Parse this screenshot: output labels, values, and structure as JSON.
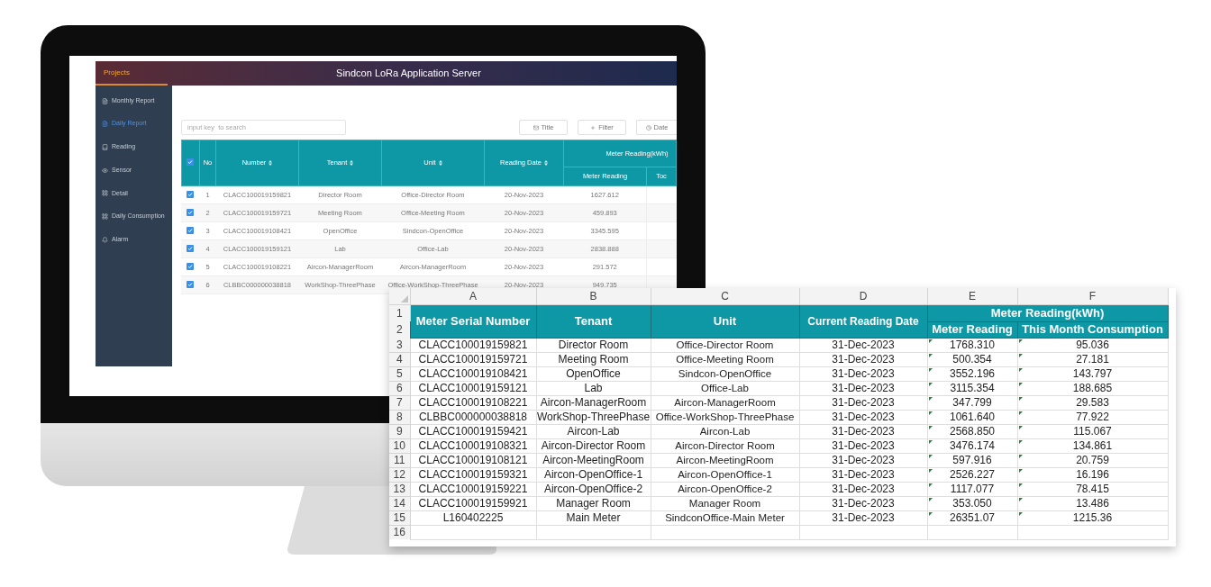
{
  "app": {
    "header": {
      "projects": "Projects",
      "title": "Sindcon LoRa Application Server"
    },
    "sidebar": [
      {
        "label": "Monthly Report",
        "selected": false
      },
      {
        "label": "Daily Report",
        "selected": true
      },
      {
        "label": "Reading",
        "selected": false
      },
      {
        "label": "Sensor",
        "selected": false
      },
      {
        "label": "Detail",
        "selected": false
      },
      {
        "label": "Daily Consumption",
        "selected": false
      },
      {
        "label": "Alarm",
        "selected": false
      }
    ],
    "search": {
      "placeholder": "input key  to search"
    },
    "buttons": [
      "Title",
      "Filter",
      "Date"
    ],
    "table": {
      "all_checked": true,
      "columns": [
        "No",
        "Number",
        "Tenant",
        "Unit",
        "Reading Date"
      ],
      "group": "Meter Reading(kWh)",
      "subcolumns": [
        "Meter Reading",
        "Toc"
      ],
      "rows": [
        {
          "checked": true,
          "cells": [
            "1",
            "CLACC100019159821",
            "Director Room",
            "Office-Director Room",
            "20-Nov-2023",
            "1627.612"
          ]
        },
        {
          "checked": true,
          "cells": [
            "2",
            "CLACC100019159721",
            "Meeting Room",
            "Office-Meeting Room",
            "20-Nov-2023",
            "459.893"
          ]
        },
        {
          "checked": true,
          "cells": [
            "3",
            "CLACC100019108421",
            "OpenOffice",
            "Sindcon-OpenOffice",
            "20-Nov-2023",
            "3345.595"
          ]
        },
        {
          "checked": true,
          "cells": [
            "4",
            "CLACC100019159121",
            "Lab",
            "Office-Lab",
            "20-Nov-2023",
            "2838.888"
          ]
        },
        {
          "checked": true,
          "cells": [
            "5",
            "CLACC100019108221",
            "Aircon-ManagerRoom",
            "Aircon-ManagerRoom",
            "20-Nov-2023",
            "291.572"
          ]
        },
        {
          "checked": true,
          "cells": [
            "6",
            "CLBBC000000038818",
            "WorkShop-ThreePhase",
            "Office-WorkShop-ThreePhase",
            "20-Nov-2023",
            "949.735"
          ]
        }
      ]
    }
  },
  "spreadsheet": {
    "column_letters": [
      "A",
      "B",
      "C",
      "D",
      "E",
      "F"
    ],
    "header_row_numbers": [
      "1",
      "2"
    ],
    "headers": [
      "Meter Serial Number",
      "Tenant",
      "Unit",
      "Current Reading Date"
    ],
    "group_header": "Meter Reading(kWh)",
    "subheaders": [
      "Meter Reading",
      "This Month Consumption"
    ],
    "rows": [
      {
        "number": "3",
        "flagged": true,
        "cells": [
          "CLACC100019159821",
          "Director Room",
          "Office-Director Room",
          "31-Dec-2023",
          "1768.310",
          "95.036"
        ]
      },
      {
        "number": "4",
        "flagged": true,
        "cells": [
          "CLACC100019159721",
          "Meeting Room",
          "Office-Meeting Room",
          "31-Dec-2023",
          "500.354",
          "27.181"
        ]
      },
      {
        "number": "5",
        "flagged": true,
        "cells": [
          "CLACC100019108421",
          "OpenOffice",
          "Sindcon-OpenOffice",
          "31-Dec-2023",
          "3552.196",
          "143.797"
        ]
      },
      {
        "number": "6",
        "flagged": true,
        "cells": [
          "CLACC100019159121",
          "Lab",
          "Office-Lab",
          "31-Dec-2023",
          "3115.354",
          "188.685"
        ]
      },
      {
        "number": "7",
        "flagged": true,
        "cells": [
          "CLACC100019108221",
          "Aircon-ManagerRoom",
          "Aircon-ManagerRoom",
          "31-Dec-2023",
          "347.799",
          "29.583"
        ]
      },
      {
        "number": "8",
        "flagged": true,
        "cells": [
          "CLBBC000000038818",
          "WorkShop-ThreePhase",
          "Office-WorkShop-ThreePhase",
          "31-Dec-2023",
          "1061.640",
          "77.922"
        ]
      },
      {
        "number": "9",
        "flagged": true,
        "cells": [
          "CLACC100019159421",
          "Aircon-Lab",
          "Aircon-Lab",
          "31-Dec-2023",
          "2568.850",
          "115.067"
        ]
      },
      {
        "number": "10",
        "flagged": true,
        "cells": [
          "CLACC100019108321",
          "Aircon-Director Room",
          "Aircon-Director Room",
          "31-Dec-2023",
          "3476.174",
          "134.861"
        ]
      },
      {
        "number": "11",
        "flagged": true,
        "cells": [
          "CLACC100019108121",
          "Aircon-MeetingRoom",
          "Aircon-MeetingRoom",
          "31-Dec-2023",
          "597.916",
          "20.759"
        ]
      },
      {
        "number": "12",
        "flagged": true,
        "cells": [
          "CLACC100019159321",
          "Aircon-OpenOffice-1",
          "Aircon-OpenOffice-1",
          "31-Dec-2023",
          "2526.227",
          "16.196"
        ]
      },
      {
        "number": "13",
        "flagged": true,
        "cells": [
          "CLACC100019159221",
          "Aircon-OpenOffice-2",
          "Aircon-OpenOffice-2",
          "31-Dec-2023",
          "1117.077",
          "78.415"
        ]
      },
      {
        "number": "14",
        "flagged": true,
        "cells": [
          "CLACC100019159921",
          "Manager Room",
          "Manager Room",
          "31-Dec-2023",
          "353.050",
          "13.486"
        ]
      },
      {
        "number": "15",
        "flagged": true,
        "cells": [
          "L160402225",
          "Main Meter",
          "SindconOffice-Main Meter",
          "31-Dec-2023",
          "26351.07",
          "1215.36"
        ]
      }
    ],
    "empty_row": "16"
  }
}
